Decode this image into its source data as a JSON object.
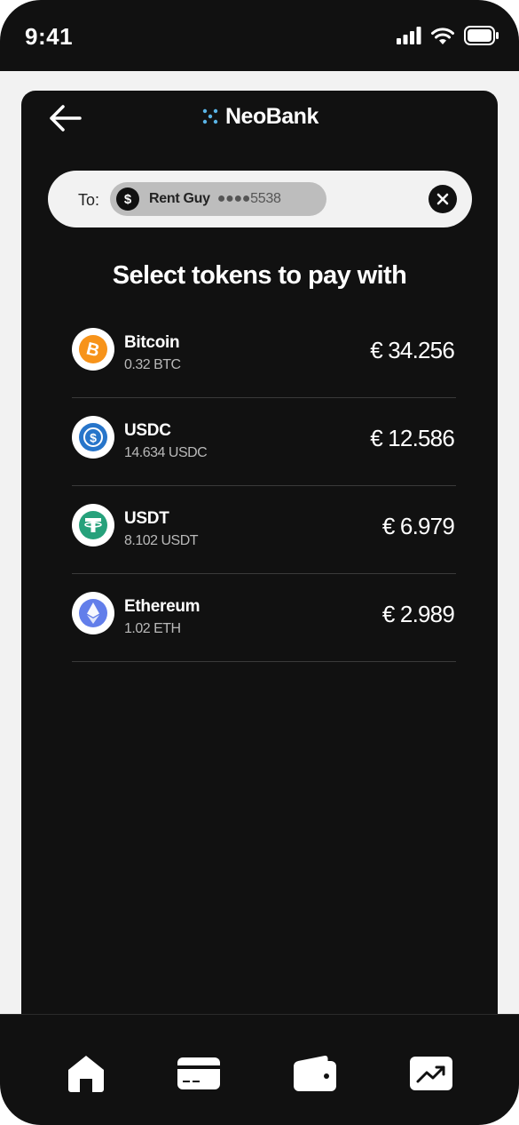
{
  "status_bar": {
    "time": "9:41"
  },
  "header": {
    "brand": "NeoBank"
  },
  "recipient": {
    "to_label": "To:",
    "icon_symbol": "$",
    "name": "Rent Guy",
    "account_masked": "●●●●5538"
  },
  "heading": "Select tokens to pay with",
  "tokens": [
    {
      "name": "Bitcoin",
      "amount": "0.32 BTC",
      "value": "€ 34.256",
      "icon": "bitcoin-icon",
      "color": "#F7931A"
    },
    {
      "name": "USDC",
      "amount": "14.634 USDC",
      "value": "€ 12.586",
      "icon": "usdc-icon",
      "color": "#2775CA"
    },
    {
      "name": "USDT",
      "amount": "8.102 USDT",
      "value": "€ 6.979",
      "icon": "tether-icon",
      "color": "#26A17B"
    },
    {
      "name": "Ethereum",
      "amount": "1.02 ETH",
      "value": "€ 2.989",
      "icon": "ethereum-icon",
      "color": "#627EEA"
    }
  ],
  "tab_bar": {
    "items": [
      {
        "icon": "home-icon"
      },
      {
        "icon": "card-icon"
      },
      {
        "icon": "wallet-icon"
      },
      {
        "icon": "chart-icon"
      }
    ]
  },
  "colors": {
    "background": "#111111",
    "surface": "#f2f2f2",
    "brand_dots": "#5ab4e6"
  }
}
